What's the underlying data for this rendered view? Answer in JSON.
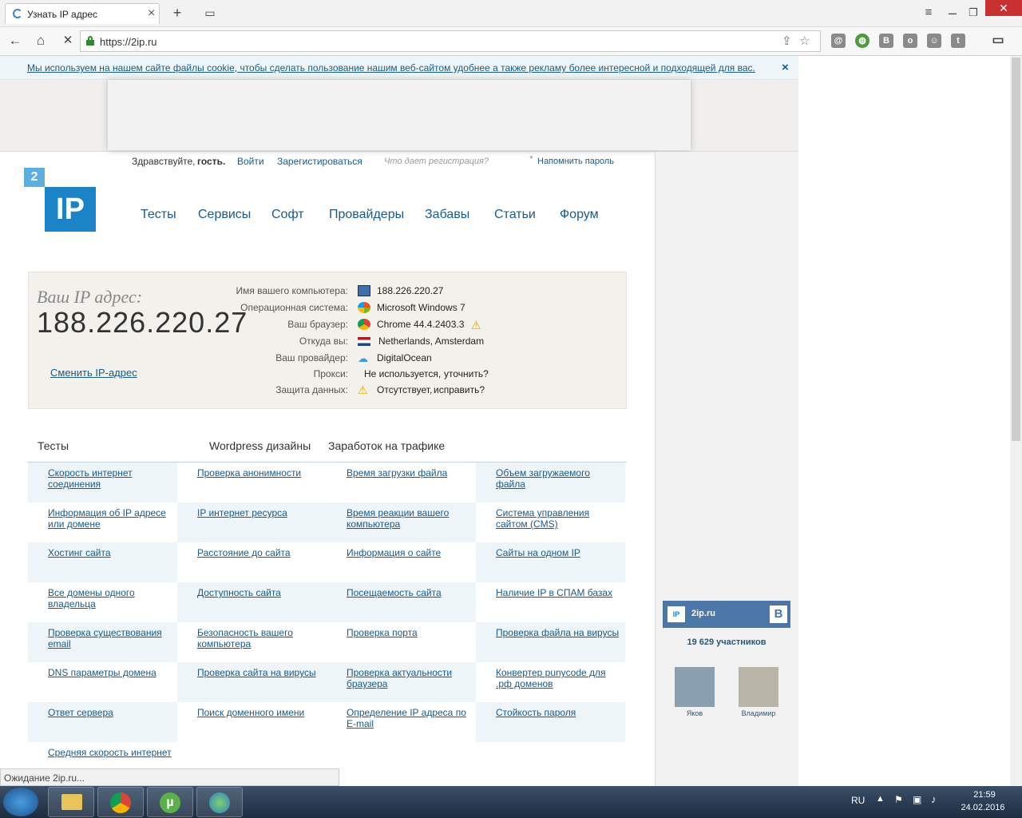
{
  "browser": {
    "tab_title": "Узнать IP адрес",
    "url": "https://2ip.ru",
    "status": "Ожидание 2ip.ru..."
  },
  "cookie": {
    "text": "Мы используем на нашем сайте файлы cookie, чтобы сделать пользование нашим веб-сайтом удобнее а также рекламу более интересной и подходящей для вас.",
    "close": "×"
  },
  "user": {
    "greeting": "Здравствуйте,",
    "guest": "гость.",
    "login": "Войти",
    "register": "Зарегистироваться",
    "reg_info": "Что дает регистрация?",
    "star": "*",
    "remind": "Напомнить пароль"
  },
  "logo": {
    "two": "2",
    "ip": "IP"
  },
  "menu": [
    "Тесты",
    "Сервисы",
    "Софт",
    "Провайдеры",
    "Забавы",
    "Статьи",
    "Форум"
  ],
  "ipinfo": {
    "label": "Ваш IP адрес:",
    "ip": "188.226.220.27",
    "change": "Сменить IP-адрес",
    "rows": [
      {
        "k": "Имя вашего компьютера:",
        "v": "188.226.220.27",
        "icon": "computer-icon"
      },
      {
        "k": "Операционная система:",
        "v": "Microsoft Windows 7",
        "icon": "windows-icon"
      },
      {
        "k": "Ваш браузер:",
        "v": "Chrome 44.4.2403.3",
        "icon": "chrome-icon"
      },
      {
        "k": "Откуда вы:",
        "v": "Netherlands, Amsterdam",
        "icon": "flag-icon"
      },
      {
        "k": "Ваш провайдер:",
        "v": "DigitalOcean",
        "icon": "cloud-icon"
      },
      {
        "k": "Прокси:",
        "v": "Не используется,",
        "link": "уточнить?"
      },
      {
        "k": "Защита данных:",
        "v": "Отсутствует,",
        "link": "исправить?",
        "icon": "warning-icon"
      }
    ]
  },
  "sections": [
    "Тесты",
    "Wordpress дизайны",
    "Заработок на трафике"
  ],
  "tests": [
    [
      "Скорость интернет соединения",
      "Проверка анонимности",
      "Время загрузки файла",
      "Объем загружаемого файла"
    ],
    [
      "Информация об IP адресе или домене",
      "IP интернет ресурса",
      "Время реакции вашего компьютера",
      "Система управления сайтом (CMS)"
    ],
    [
      "Хостинг сайта",
      "Расстояние до сайта",
      "Информация о сайте",
      "Сайты на одном IP"
    ],
    [
      "Все домены одного владельца",
      "Доступность сайта",
      "Посещаемость сайта",
      "Наличие IP в СПАМ базах"
    ],
    [
      "Проверка существования email",
      "Безопасность вашего компьютера",
      "Проверка порта",
      "Проверка файла на вирусы"
    ],
    [
      "DNS параметры домена",
      "Проверка сайта на вирусы",
      "Проверка актуальности браузера",
      "Конвертер punycode для .рф доменов"
    ],
    [
      "Ответ сервера",
      "Поиск доменного имени",
      "Определение IP адреса по E-mail",
      "Стойкость пароля"
    ],
    [
      "Средняя скорость интернет"
    ]
  ],
  "vk": {
    "name": "2ip.ru",
    "members": "19 629 участников",
    "people": [
      "Яков",
      "Владимир"
    ]
  },
  "tray": {
    "lang": "RU",
    "time": "21:59",
    "date": "24.02.2016"
  }
}
